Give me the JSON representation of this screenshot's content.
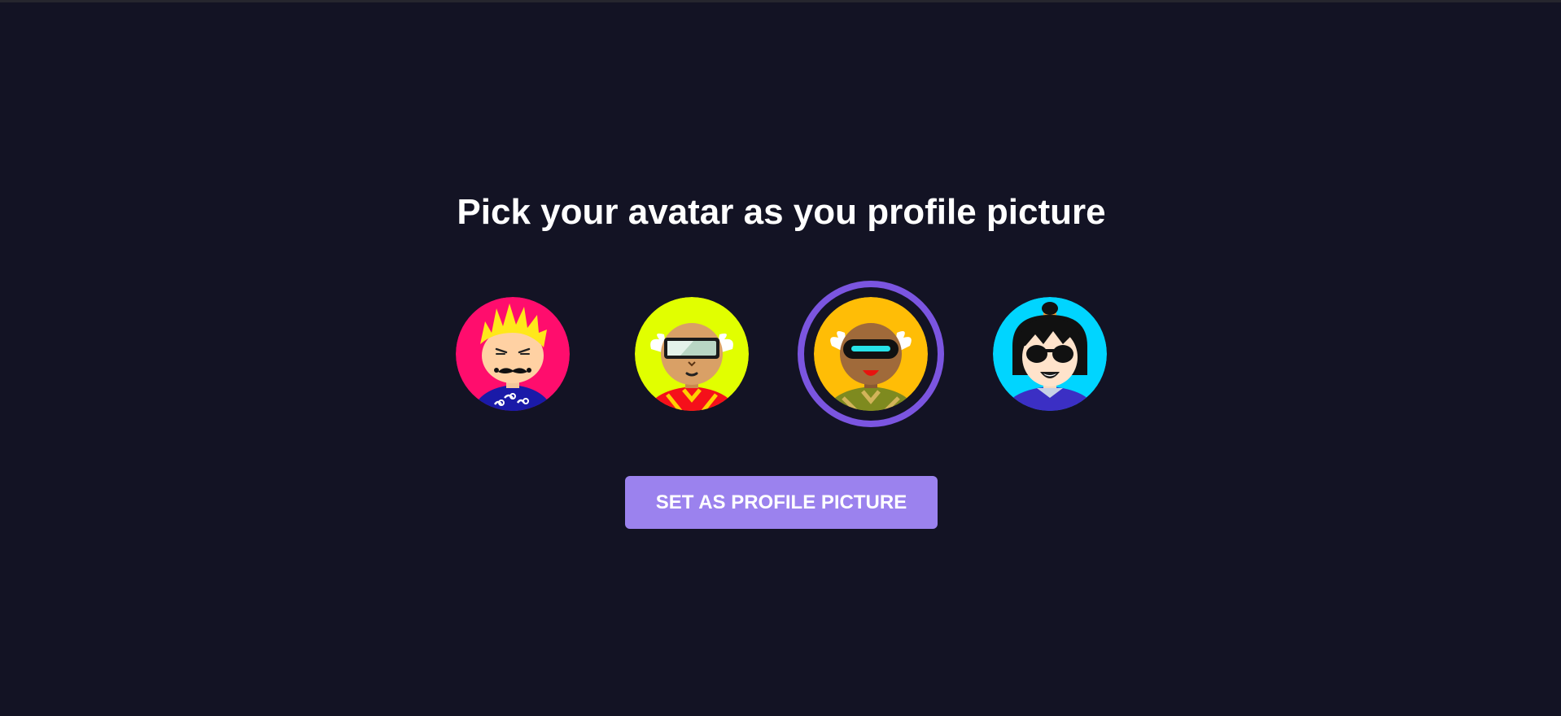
{
  "page": {
    "title": "Pick your avatar as you profile picture"
  },
  "avatars": [
    {
      "id": "avatar-1",
      "background": "#ff0d6d",
      "selected": false
    },
    {
      "id": "avatar-2",
      "background": "#e1ff00",
      "selected": false
    },
    {
      "id": "avatar-3",
      "background": "#ffbd06",
      "selected": true
    },
    {
      "id": "avatar-4",
      "background": "#00d5ff",
      "selected": false
    }
  ],
  "colors": {
    "page_background": "#131324",
    "selected_ring": "#7b55e0",
    "button_background": "#9b82ee",
    "text": "#ffffff"
  },
  "actions": {
    "set_profile_label": "SET AS PROFILE PICTURE"
  }
}
